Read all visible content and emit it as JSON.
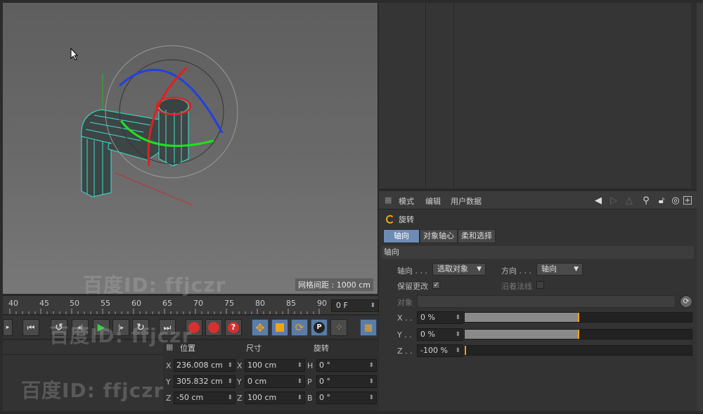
{
  "viewport": {
    "grid_spacing": "网格间距 : 1000 cm"
  },
  "timeline": {
    "ticks": [
      "40",
      "45",
      "50",
      "55",
      "60",
      "65",
      "70",
      "75",
      "80",
      "85",
      "90"
    ],
    "current_frame": "0 F"
  },
  "coords": {
    "headers": {
      "position": "位置",
      "size": "尺寸",
      "rotation": "旋转"
    },
    "rows": [
      {
        "pos_axis": "X",
        "pos_value": "236.008 cm",
        "size_axis": "X",
        "size_value": "100 cm",
        "rot_axis": "H",
        "rot_value": "0 °"
      },
      {
        "pos_axis": "Y",
        "pos_value": "305.832 cm",
        "size_axis": "Y",
        "size_value": "0 cm",
        "rot_axis": "P",
        "rot_value": "0 °"
      },
      {
        "pos_axis": "Z",
        "pos_value": "-50 cm",
        "size_axis": "Z",
        "size_value": "100 cm",
        "rot_axis": "B",
        "rot_value": "0 °"
      }
    ]
  },
  "attributes": {
    "menu": {
      "mode": "模式",
      "edit": "编辑",
      "user_data": "用户数据"
    },
    "object_name": "旋转",
    "tabs": [
      "轴向",
      "对象轴心",
      "柔和选择"
    ],
    "active_tab": 0,
    "section_title": "轴向",
    "axis_label": "轴向 . . .",
    "axis_value": "选取对象",
    "direction_label": "方向 . . .",
    "direction_value": "轴向",
    "keep_changes_label": "保留更改",
    "along_normal_label": "沿着法线",
    "object_label": "对象",
    "x_label": "X . .",
    "x_value": "0 %",
    "x_fill": 0.5,
    "y_label": "Y . .",
    "y_value": "0 %",
    "y_fill": 0.5,
    "z_label": "Z . .",
    "z_value": "-100 %",
    "z_fill": 0.0
  },
  "watermark": "百度ID: ffjczr",
  "colors": {
    "accent_blue": "#6e8bb5",
    "slider_marker": "#f0a21a",
    "mesh_cyan": "#3ee0d0",
    "gizmo_red": "#e02020",
    "gizmo_green": "#20e020",
    "gizmo_blue": "#2040e0"
  }
}
